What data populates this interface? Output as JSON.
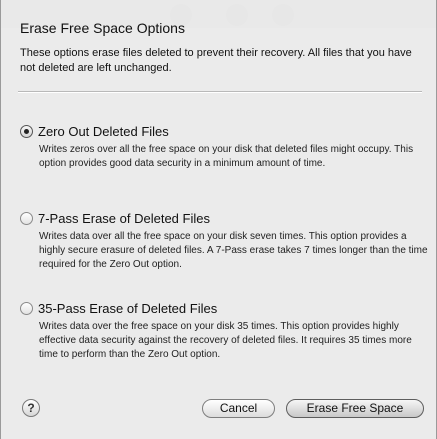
{
  "sheet": {
    "title": "Erase Free Space Options",
    "intro": "These options erase files deleted to prevent their recovery. All files that you have not deleted are left unchanged."
  },
  "options": [
    {
      "label": "Zero Out Deleted Files",
      "description": "Writes zeros over all the free space on your disk that deleted files might occupy. This option provides good data security in a minimum amount of time.",
      "selected": true
    },
    {
      "label": "7-Pass Erase of Deleted Files",
      "description": "Writes data over all the free space on your disk seven times. This option provides a highly secure erasure of deleted files. A 7-Pass erase takes 7 times longer than the time required for the Zero Out option.",
      "selected": false
    },
    {
      "label": "35-Pass Erase of Deleted Files",
      "description": "Writes data over the free space on your disk 35 times. This option provides highly effective data security against the recovery of deleted files. It requires 35 times more time to perform than the Zero Out option.",
      "selected": false
    }
  ],
  "footer": {
    "help_label": "?",
    "cancel_label": "Cancel",
    "confirm_label": "Erase Free Space"
  },
  "icons": {
    "help": "question-mark-icon",
    "radio_selected": "radio-selected-icon",
    "radio_unselected": "radio-unselected-icon"
  },
  "colors": {
    "sheet_background": "#ececec",
    "text": "#111111"
  }
}
